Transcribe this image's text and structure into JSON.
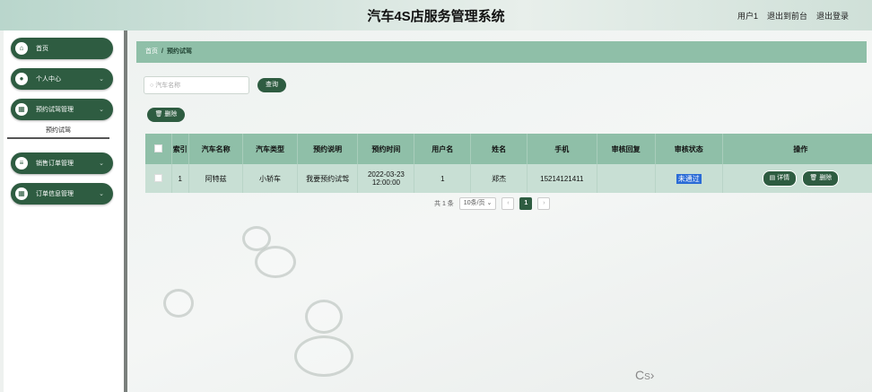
{
  "header": {
    "title": "汽车4S店服务管理系统",
    "user": "用户1",
    "back_to_admin": "退出到前台",
    "logout": "退出登录"
  },
  "sidebar": {
    "items": [
      {
        "label": "首页",
        "icon": "home-icon"
      },
      {
        "label": "个人中心",
        "icon": "person-icon"
      },
      {
        "label": "预约试驾管理",
        "icon": "grid-icon"
      },
      {
        "label": "销售订单管理",
        "icon": "list-icon"
      },
      {
        "label": "订单信息管理",
        "icon": "grid-icon"
      }
    ],
    "sub_item": "预约试驾"
  },
  "breadcrumb": {
    "home": "首页",
    "separator": "/",
    "current": "预约试驾"
  },
  "search": {
    "placeholder": "汽车名称",
    "button": "查询"
  },
  "toolbar": {
    "delete": "删除"
  },
  "table": {
    "columns": [
      "索引",
      "汽车名称",
      "汽车类型",
      "预约说明",
      "预约时间",
      "用户名",
      "姓名",
      "手机",
      "审核回复",
      "审核状态",
      "操作"
    ],
    "rows": [
      {
        "index": "1",
        "car_name": "阿特兹",
        "car_type": "小轿车",
        "note": "我要预约试驾",
        "time": "2022-03-23 12:00:00",
        "username": "1",
        "name": "郑杰",
        "phone": "15214121411",
        "reply": "",
        "status": "未通过",
        "detail_btn": "详情",
        "delete_btn": "删除"
      }
    ]
  },
  "pager": {
    "total": "共 1 条",
    "page_size": "10条/页",
    "current_page": "1"
  },
  "colors": {
    "primary": "#2e5c41",
    "header_row": "#8fbfa8",
    "body_row": "#c8dfd4"
  }
}
